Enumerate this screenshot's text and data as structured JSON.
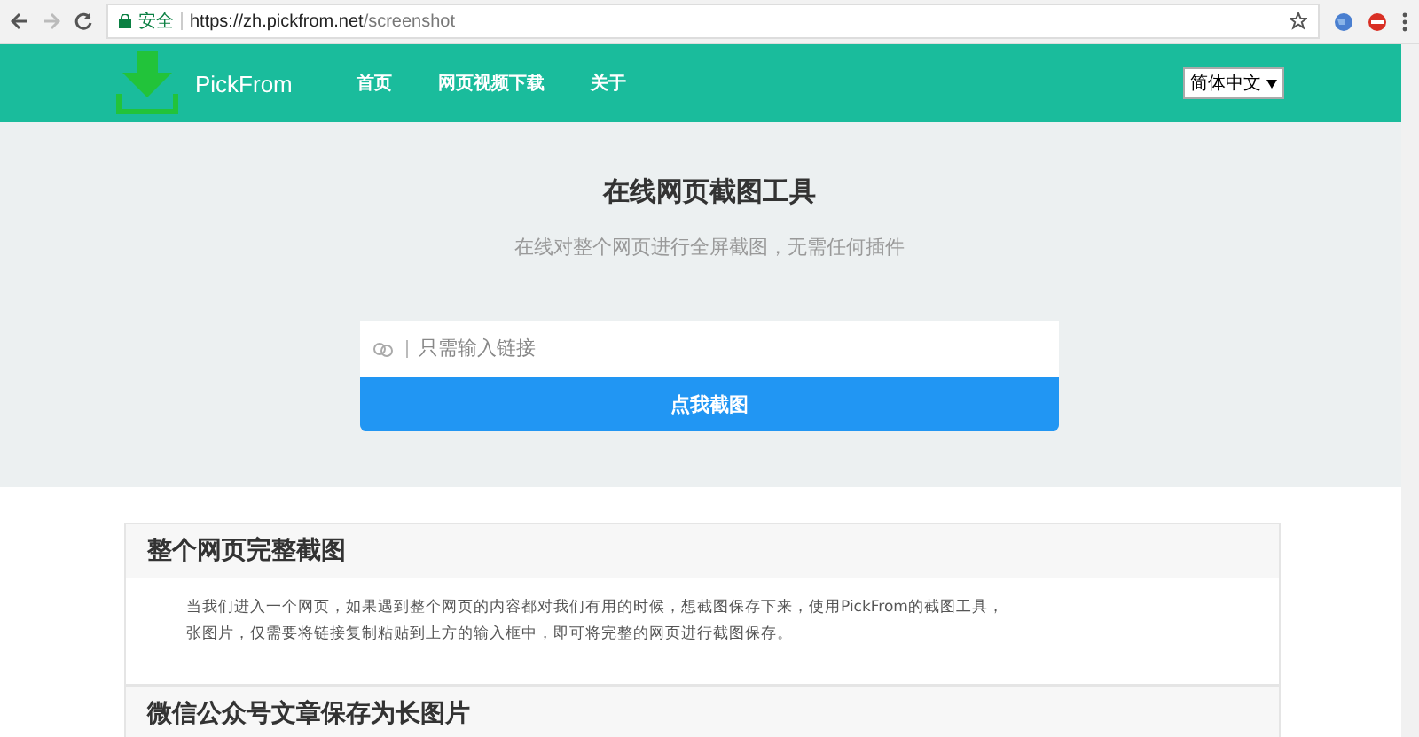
{
  "browser": {
    "secure_label": "安全",
    "url_host": "https://zh.pickfrom.net",
    "url_path": "/screenshot"
  },
  "nav": {
    "brand": "PickFrom",
    "links": [
      {
        "label": "首页"
      },
      {
        "label": "网页视频下载"
      },
      {
        "label": "关于"
      }
    ],
    "language": "简体中文"
  },
  "hero": {
    "title": "在线网页截图工具",
    "subtitle": "在线对整个网页进行全屏截图，无需任何插件",
    "input": {
      "placeholder": "只需输入链接"
    },
    "button": "点我截图"
  },
  "sections": [
    {
      "title": "整个网页完整截图",
      "lines": [
        "当我们进入一个网页，如果遇到整个网页的内容都对我们有用的时候，想截图保存下来，使用PickFrom的截图工具，",
        "张图片，仅需要将链接复制粘贴到上方的输入框中，即可将完整的网页进行截图保存。"
      ]
    },
    {
      "title": "微信公众号文章保存为长图片"
    }
  ]
}
